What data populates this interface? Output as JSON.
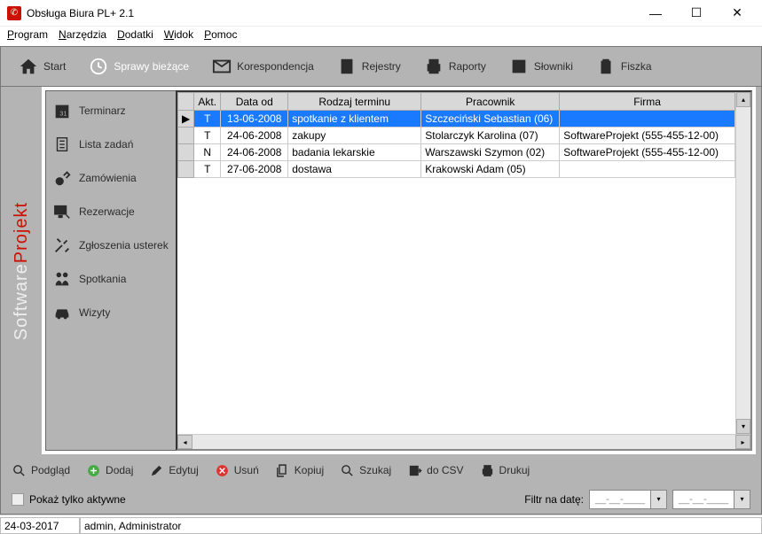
{
  "window": {
    "title": "Obsługa Biura PL+ 2.1"
  },
  "menu": {
    "program": "Program",
    "narzedzia": "Narzędzia",
    "dodatki": "Dodatki",
    "widok": "Widok",
    "pomoc": "Pomoc"
  },
  "toolbar": {
    "start": "Start",
    "sprawy": "Sprawy bieżące",
    "korespondencja": "Korespondencja",
    "rejestry": "Rejestry",
    "raporty": "Raporty",
    "slowniki": "Słowniki",
    "fiszka": "Fiszka"
  },
  "brand": {
    "prefix": "Software",
    "accent": "Projekt"
  },
  "sidebar": [
    {
      "id": "terminarz",
      "label": "Terminarz"
    },
    {
      "id": "lista-zadan",
      "label": "Lista zadań"
    },
    {
      "id": "zamowienia",
      "label": "Zamówienia"
    },
    {
      "id": "rezerwacje",
      "label": "Rezerwacje"
    },
    {
      "id": "zgloszenia",
      "label": "Zgłoszenia usterek"
    },
    {
      "id": "spotkania",
      "label": "Spotkania"
    },
    {
      "id": "wizyty",
      "label": "Wizyty"
    }
  ],
  "table": {
    "headers": {
      "akt": "Akt.",
      "data_od": "Data od",
      "rodzaj": "Rodzaj terminu",
      "pracownik": "Pracownik",
      "firma": "Firma"
    },
    "rows": [
      {
        "akt": "T",
        "data_od": "13-06-2008",
        "rodzaj": "spotkanie z klientem",
        "pracownik": "Szczeciński Sebastian (06)",
        "firma": "",
        "selected": true
      },
      {
        "akt": "T",
        "data_od": "24-06-2008",
        "rodzaj": "zakupy",
        "pracownik": "Stolarczyk Karolina (07)",
        "firma": "SoftwareProjekt (555-455-12-00)"
      },
      {
        "akt": "N",
        "data_od": "24-06-2008",
        "rodzaj": "badania lekarskie",
        "pracownik": "Warszawski Szymon (02)",
        "firma": "SoftwareProjekt (555-455-12-00)"
      },
      {
        "akt": "T",
        "data_od": "27-06-2008",
        "rodzaj": "dostawa",
        "pracownik": "Krakowski Adam (05)",
        "firma": ""
      }
    ]
  },
  "actions": {
    "podglad": "Podgląd",
    "dodaj": "Dodaj",
    "edytuj": "Edytuj",
    "usun": "Usuń",
    "kopiuj": "Kopiuj",
    "szukaj": "Szukaj",
    "csv": "do CSV",
    "drukuj": "Drukuj"
  },
  "filter": {
    "aktywne": "Pokaż tylko aktywne",
    "filtr_date": "Filtr na datę:",
    "date_ph": "__-__-____"
  },
  "status": {
    "date": "24-03-2017",
    "user": "admin, Administrator"
  }
}
